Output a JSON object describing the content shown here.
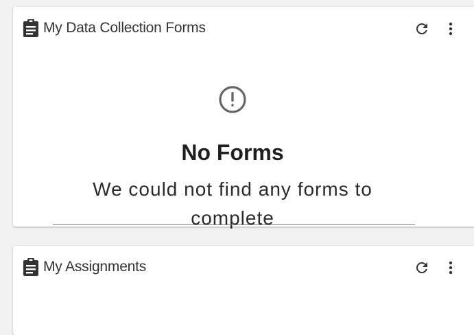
{
  "forms_card": {
    "title": "My Data Collection Forms",
    "icon": "clipboard-icon",
    "refresh_icon": "refresh-icon",
    "menu_icon": "more-vert-icon",
    "empty_state": {
      "icon": "alert-circle-icon",
      "title": "No Forms",
      "message": "We could not find any forms to complete"
    }
  },
  "assignments_card": {
    "title": "My Assignments",
    "icon": "clipboard-icon",
    "refresh_icon": "refresh-icon",
    "menu_icon": "more-vert-icon"
  },
  "colors": {
    "background": "#f2f2f2",
    "card": "#ffffff",
    "icon": "#333333",
    "empty_icon": "#666666",
    "text": "#2b2b2b"
  }
}
